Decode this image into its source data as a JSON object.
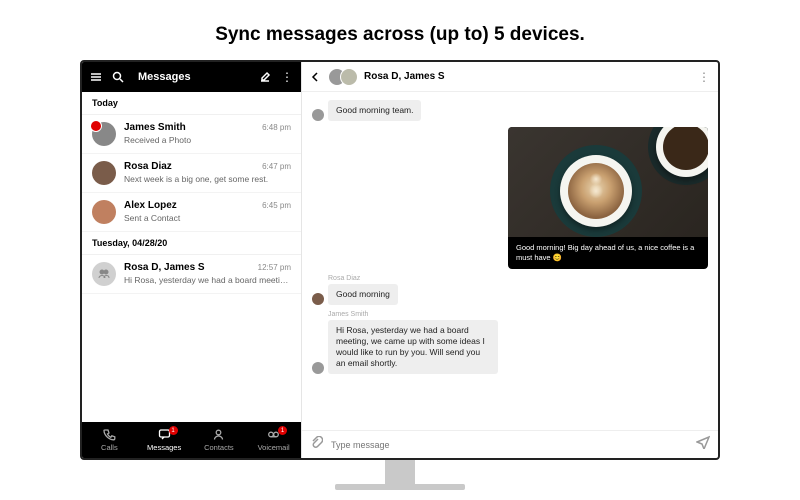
{
  "hero": "Sync messages across (up to) 5 devices.",
  "sidebar": {
    "title": "Messages",
    "sections": [
      {
        "header": "Today",
        "items": [
          {
            "name": "James Smith",
            "preview": "Received a Photo",
            "time": "6:48 pm",
            "unread": true
          },
          {
            "name": "Rosa Diaz",
            "preview": "Next week is a big one, get some rest.",
            "time": "6:47 pm",
            "unread": false
          },
          {
            "name": "Alex Lopez",
            "preview": "Sent a Contact",
            "time": "6:45 pm",
            "unread": false
          }
        ]
      },
      {
        "header": "Tuesday, 04/28/20",
        "items": [
          {
            "name": "Rosa D, James S",
            "preview": "Hi Rosa, yesterday we had a board meeting, we...",
            "time": "12:57 pm",
            "unread": false,
            "group": true
          }
        ]
      }
    ]
  },
  "tabs": [
    {
      "label": "Calls",
      "badge": null
    },
    {
      "label": "Messages",
      "badge": "1",
      "active": true
    },
    {
      "label": "Contacts",
      "badge": null
    },
    {
      "label": "Voicemail",
      "badge": "1"
    }
  ],
  "chat": {
    "title": "Rosa D, James S",
    "messages": [
      {
        "type": "in",
        "text": "Good morning team."
      },
      {
        "type": "photo",
        "caption": "Good morning! Big day ahead of us, a nice coffee is a must have 😊"
      },
      {
        "sender": "Rosa Diaz"
      },
      {
        "type": "in",
        "text": "Good morning"
      },
      {
        "sender": "James Smith"
      },
      {
        "type": "in",
        "text": "Hi Rosa, yesterday we had a board meeting, we came up with some ideas I would like to run by you. Will send you an email shortly."
      }
    ],
    "composer_placeholder": "Type message"
  }
}
